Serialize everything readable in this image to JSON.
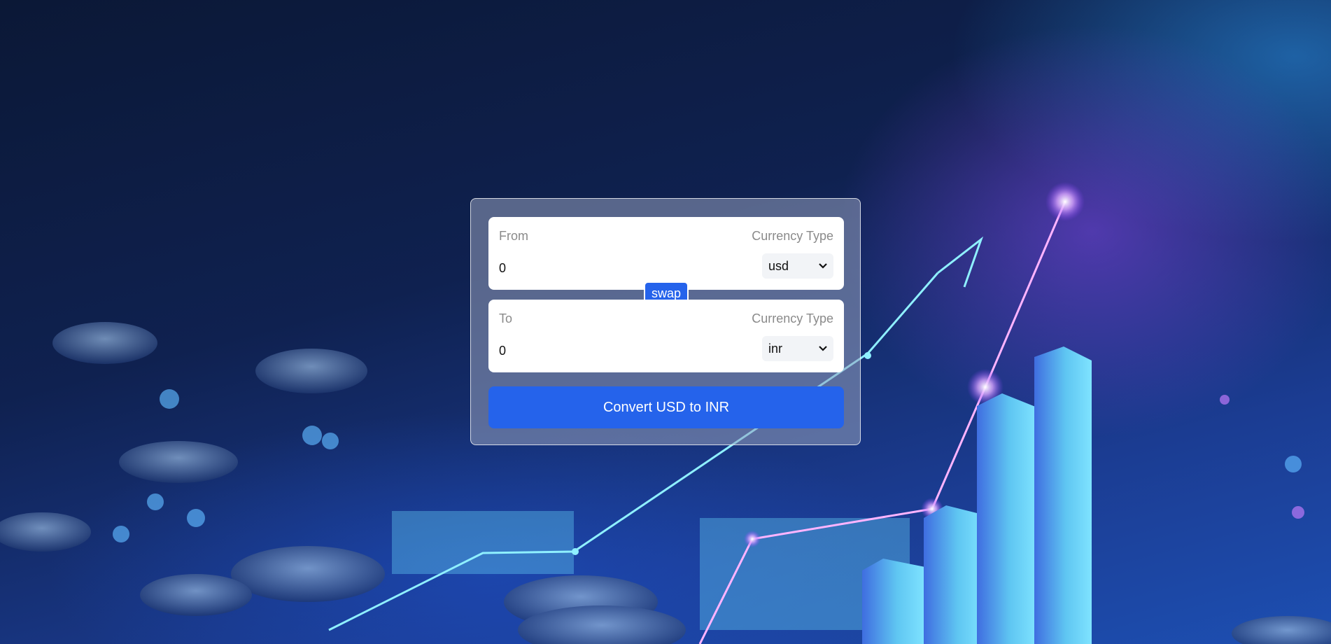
{
  "from": {
    "label": "From",
    "currency_type_label": "Currency Type",
    "amount": "0",
    "currency": "usd"
  },
  "swap_label": "swap",
  "to": {
    "label": "To",
    "currency_type_label": "Currency Type",
    "amount": "0",
    "currency": "inr"
  },
  "convert_label": "Convert USD to INR",
  "colors": {
    "accent": "#2563eb",
    "panel": "#ffffff",
    "muted_text": "#8a8a8a"
  },
  "icons": {
    "select_indicator": "chevron-down-icon"
  }
}
